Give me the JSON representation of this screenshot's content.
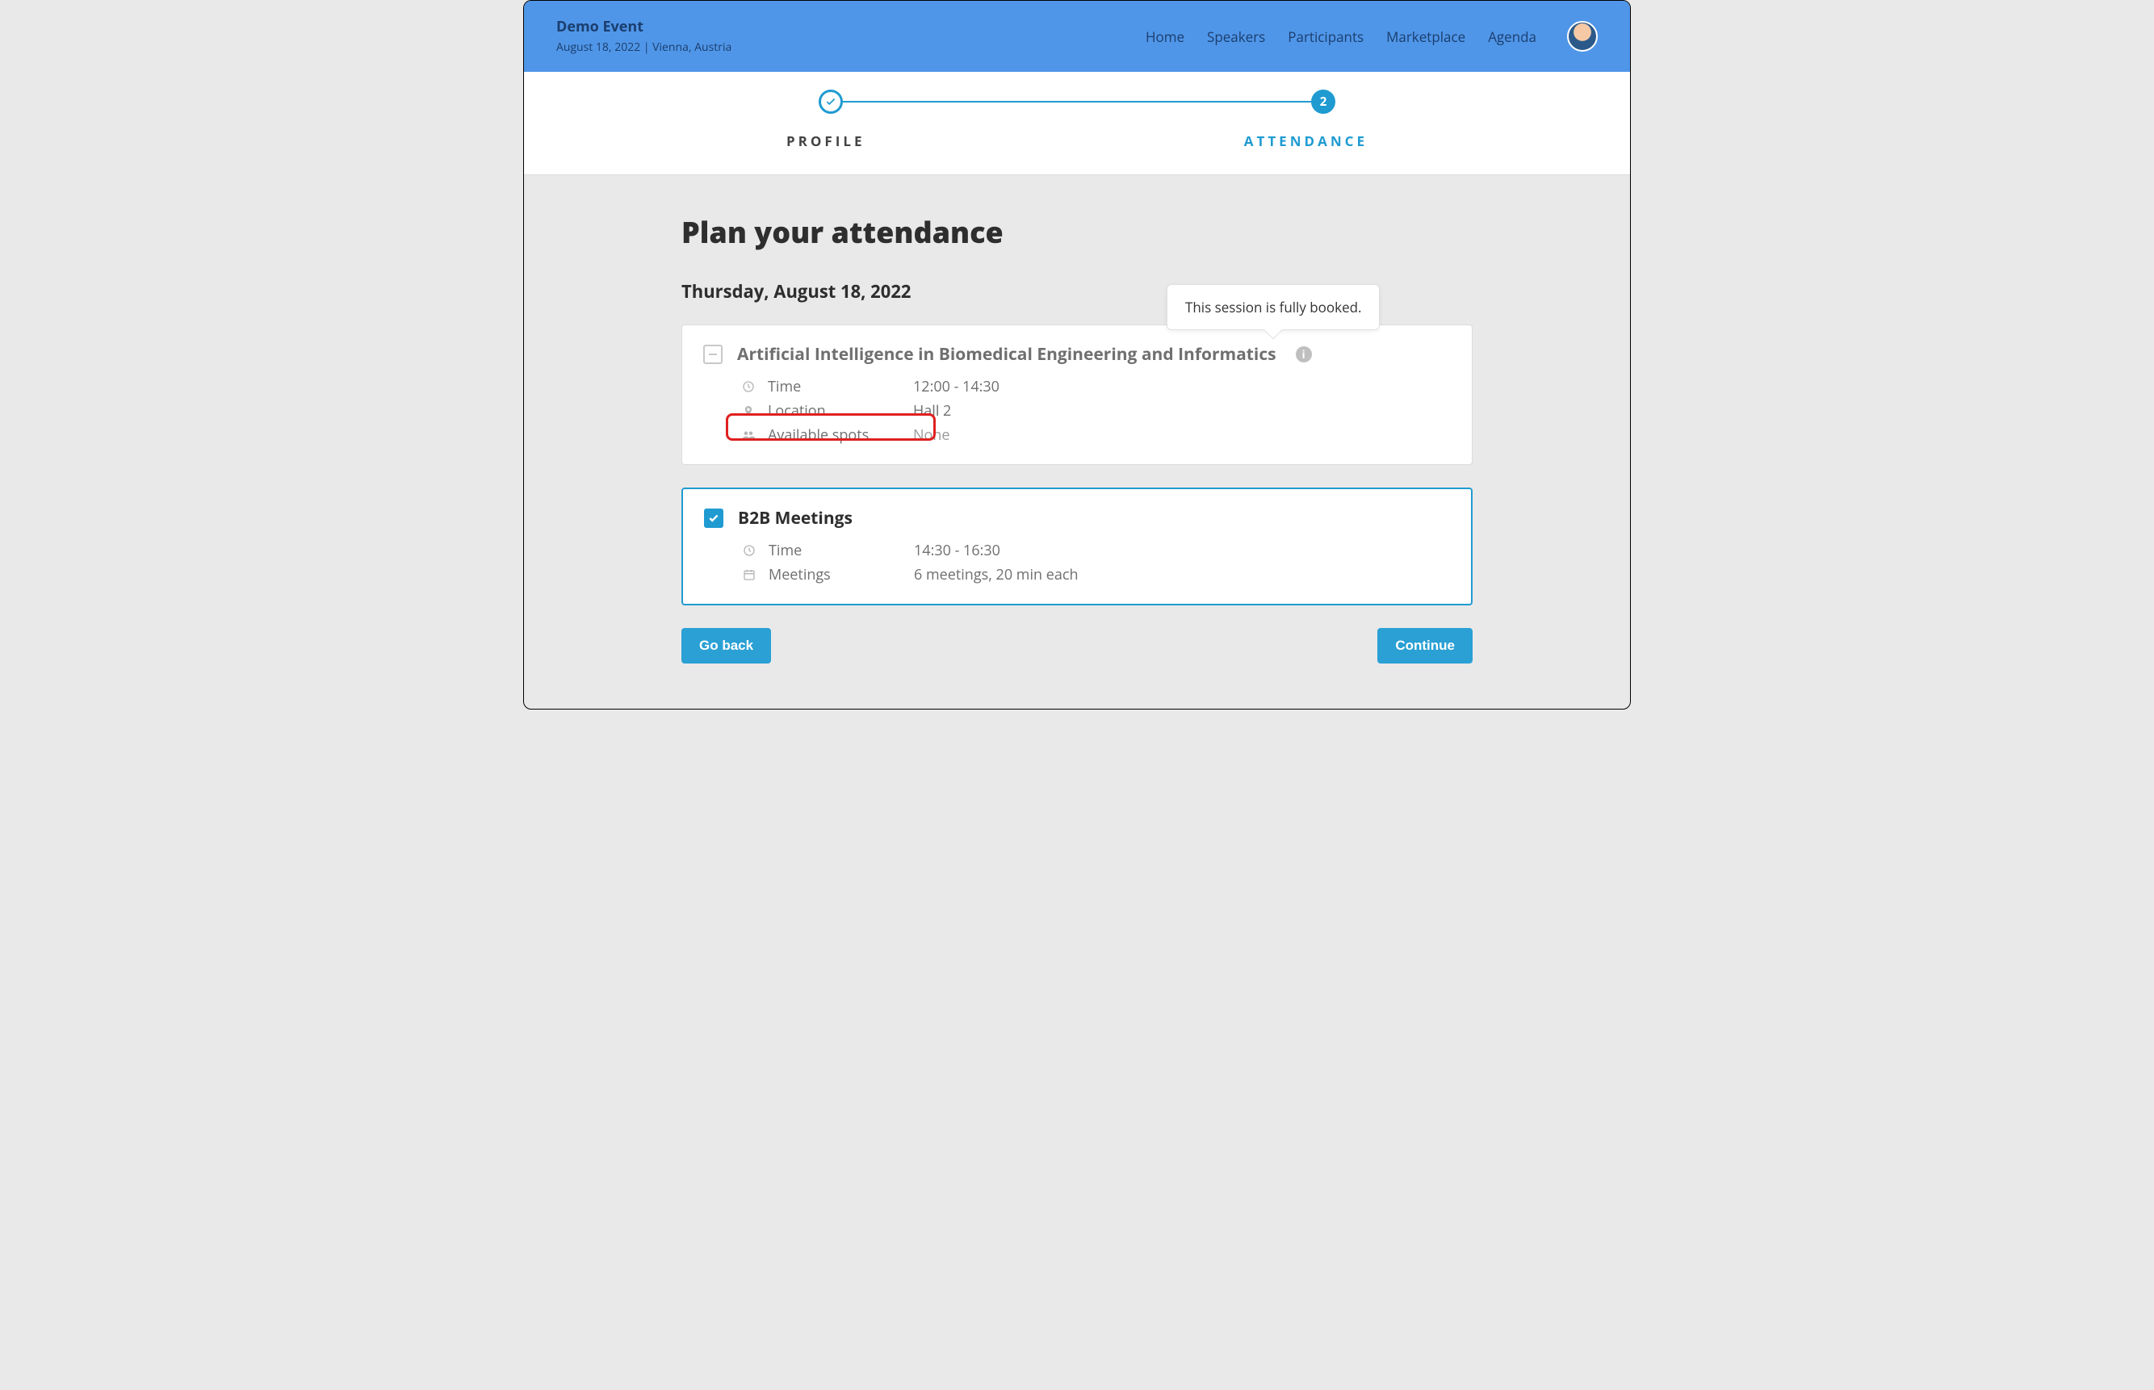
{
  "header": {
    "event_title": "Demo Event",
    "event_subtitle": "August 18, 2022 | Vienna, Austria",
    "nav": [
      "Home",
      "Speakers",
      "Participants",
      "Marketplace",
      "Agenda"
    ]
  },
  "stepper": {
    "step1_label": "PROFILE",
    "step2_number": "2",
    "step2_label": "ATTENDANCE"
  },
  "main": {
    "page_title": "Plan your attendance",
    "date_heading": "Thursday, August 18, 2022"
  },
  "session1": {
    "title": "Artificial Intelligence in Biomedical Engineering and Informatics",
    "time_label": "Time",
    "time_value": "12:00 - 14:30",
    "location_label": "Location",
    "location_value": "Hall 2",
    "spots_label": "Available spots",
    "spots_value": "None",
    "tooltip": "This session is fully booked."
  },
  "session2": {
    "title": "B2B Meetings",
    "time_label": "Time",
    "time_value": "14:30 - 16:30",
    "meetings_label": "Meetings",
    "meetings_value": "6 meetings, 20 min each"
  },
  "actions": {
    "back": "Go back",
    "continue": "Continue"
  }
}
